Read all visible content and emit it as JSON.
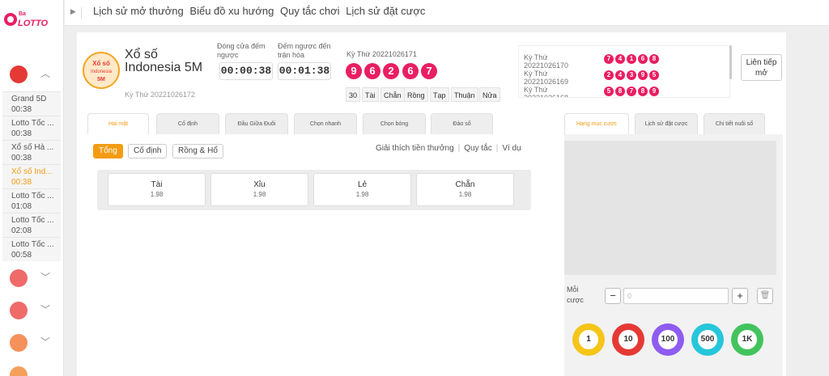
{
  "brand": {
    "logo_text": "LOTTO",
    "logo_prefix": "Ba"
  },
  "topnav": {
    "links": [
      "Lịch sử mở thưởng",
      "Biểu đồ xu hướng",
      "Quy tắc chơi",
      "Lịch sử đặt cược"
    ]
  },
  "sidebar": {
    "games": [
      {
        "name": "Grand 5D",
        "time": "00:38"
      },
      {
        "name": "Lotto Tốc ...",
        "time": "00:38"
      },
      {
        "name": "Xổ số Hà ...",
        "time": "00:38"
      },
      {
        "name": "Xổ số Ind...",
        "time": "00:38"
      },
      {
        "name": "Lotto Tốc ...",
        "time": "01:08"
      },
      {
        "name": "Lotto Tốc ...",
        "time": "02:08"
      },
      {
        "name": "Lotto Tốc ...",
        "time": "00:58"
      }
    ]
  },
  "game": {
    "name": "Xổ số Indonesia 5M",
    "issue": "Kỳ Thứ 20221026172",
    "logo_text": "Xổ số",
    "logo_sub": "Indonesia",
    "logo_tag": "5M"
  },
  "countdown": {
    "close_label": "Đóng cửa đếm ngược",
    "close_value": "00:00:38",
    "draw_label": "Đếm ngược đến trận hòa",
    "draw_value": "00:01:38"
  },
  "previous": {
    "label": "Kỳ Thứ 20221026171",
    "balls": [
      "9",
      "6",
      "2",
      "6",
      "7"
    ],
    "tags": [
      "30",
      "Tài",
      "Chẵn",
      "Rồng",
      "Tạp",
      "Thuận",
      "Nửa"
    ]
  },
  "history": [
    {
      "label": "Kỳ Thứ 20221026170",
      "balls": [
        "7",
        "4",
        "1",
        "6",
        "8"
      ]
    },
    {
      "label": "Kỳ Thứ 20221026169",
      "balls": [
        "2",
        "4",
        "3",
        "9",
        "5"
      ]
    },
    {
      "label": "Kỳ Thứ 20221026168",
      "balls": [
        "5",
        "8",
        "7",
        "8",
        "9"
      ]
    }
  ],
  "next_button": "Liên tiếp mở",
  "tabs": [
    "Hai mặt",
    "Cố định",
    "Đầu Giữa Đuôi",
    "Chọn nhanh",
    "Chọn bóng",
    "Đảo số"
  ],
  "subtabs": [
    "Tổng",
    "Cố định",
    "Rồng & Hổ"
  ],
  "right_links": [
    "Giải thích tiền thưởng",
    "Quy tắc",
    "Ví dụ"
  ],
  "options": [
    {
      "name": "Tài",
      "odds": "1.98"
    },
    {
      "name": "Xỉu",
      "odds": "1.98"
    },
    {
      "name": "Lẻ",
      "odds": "1.98"
    },
    {
      "name": "Chẵn",
      "odds": "1.98"
    }
  ],
  "slip": {
    "tabs": [
      "Hạng mục cược",
      "Lịch sử đặt cược",
      "Chi tiết nuôi số"
    ],
    "stake_label": "Mỗi cược",
    "stake_placeholder": "0",
    "minus": "−",
    "plus": "+",
    "chips": [
      "1",
      "10",
      "100",
      "500",
      "1K"
    ]
  },
  "colors": {
    "accent": "#f39c12",
    "ball": "#e91e63",
    "chips": [
      "#f5c518",
      "#e53935",
      "#8e5cf0",
      "#26c6da",
      "#43c35e"
    ]
  }
}
